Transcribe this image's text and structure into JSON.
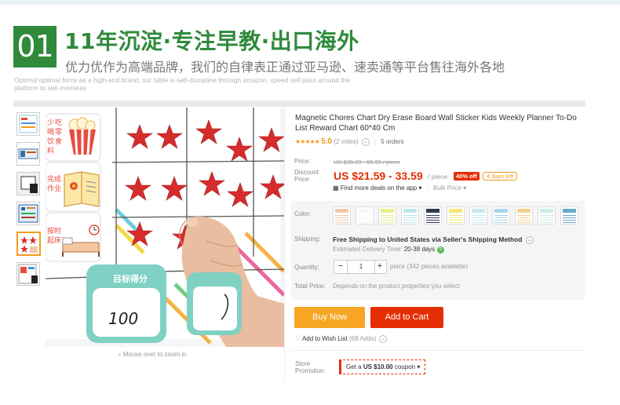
{
  "header": {
    "number": "01",
    "title": "11年沉淀·专注早教·出口海外",
    "subtitle": "优力优作为高端品牌，我们的自律表正通过亚马逊、速卖通等平台售往海外各地",
    "english": "Optimal optimal force as a high-end brand, our table is self-discipline through amazon, speed sell pass around the platform to sell overseas"
  },
  "gallery": {
    "zoom_hint": "Mouse over to zoom in",
    "image_texts": [
      "少",
      "喝",
      "饮",
      "料",
      "吃",
      "零",
      "食",
      "完成",
      "作业",
      "按时",
      "起床",
      "目标得分",
      "100"
    ]
  },
  "product": {
    "title": "Magnetic Chores Chart Dry Erase Board Wall Sticker Kids Weekly Planner To-Do List Reward Chart 60*40 Cm",
    "rating_stars": "★★★★★",
    "rating_score": "5.0",
    "votes": "(2 votes)",
    "orders": "5 orders"
  },
  "price": {
    "price_label": "Price:",
    "old_price": "US $35.99 - 55.99 / piece",
    "discount_label": "Discount Price:",
    "current_price": "US $21.59 - 33.59",
    "per_piece": "/ piece",
    "off_badge": "40% off",
    "days_left": "4 days left",
    "app_deals": "Find more deals on the app",
    "bulk_price": "Bulk Price"
  },
  "options": {
    "color_label": "Color:",
    "swatch_colors": [
      "#f3c7a8",
      "#f7f7f7",
      "#e6ef8b",
      "#bde4ea",
      "#2e3a54",
      "#f2e67a",
      "#c8e9ef",
      "#a9d7e8",
      "#f3d28a",
      "#c9eee8",
      "#6aa9c9"
    ],
    "shipping_label": "Shipping:",
    "shipping_text": "Free Shipping to United States via Seller's Shipping Method",
    "eta_label": "Estimated Delivery Time:",
    "eta_value": "20-38 days",
    "quantity_label": "Quantity:",
    "quantity_minus": "−",
    "quantity_value": "1",
    "quantity_plus": "+",
    "quantity_available": "piece (342 pieces available)",
    "total_label": "Total Price:",
    "total_text": "Depends on the product properties you select"
  },
  "actions": {
    "buy_now": "Buy Now",
    "add_to_cart": "Add to Cart",
    "wishlist": "Add to Wish List",
    "wishlist_count": "(68 Adds)"
  },
  "promotion": {
    "label": "Store Promotion:",
    "coupon_prefix": "Get a",
    "coupon_amount": "US $10.00",
    "coupon_suffix": "coupon"
  },
  "colors": {
    "brand_green": "#2f8a3c",
    "price_red": "#e62e04",
    "buy_orange": "#f6a623",
    "rating_orange": "#f39a1e"
  }
}
